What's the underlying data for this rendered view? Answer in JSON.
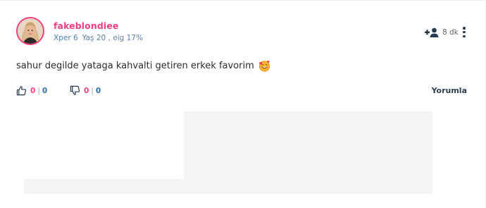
{
  "post": {
    "author": {
      "username": "fakeblondiee",
      "level": "Xper 6",
      "age": "Yaş 20 , eig 17%"
    },
    "time": "8 dk",
    "text": "sahur degilde yataga kahvalti getiren erkek favorim",
    "emoji": "smiling-face-with-hearts-emoji",
    "likes": {
      "count": "0",
      "sep": "|",
      "total": "0"
    },
    "dislikes": {
      "count": "0",
      "sep": "|",
      "total": "0"
    },
    "comment_label": "Yorumla"
  },
  "colors": {
    "accent_pink": "#ee3f80",
    "link_blue": "#2b6fb8",
    "dark": "#263a52"
  },
  "icons": {
    "follow": "add-user-icon",
    "more": "more-vertical-icon",
    "like": "thumbs-up-icon",
    "dislike": "thumbs-down-icon"
  }
}
